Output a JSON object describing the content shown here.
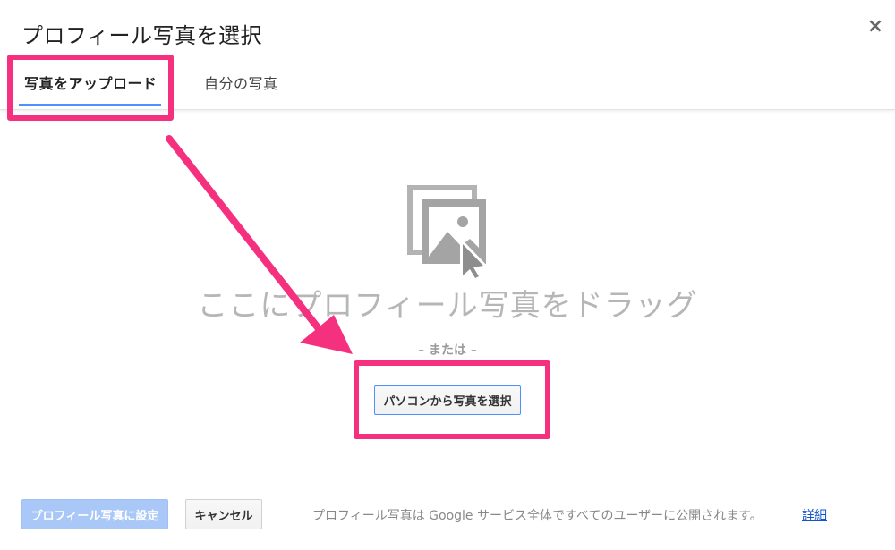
{
  "dialog": {
    "title": "プロフィール写真を選択",
    "close_icon": "close-icon",
    "close_glyph": "×"
  },
  "tabs": [
    {
      "label": "写真をアップロード",
      "active": true
    },
    {
      "label": "自分の写真",
      "active": false
    }
  ],
  "upload_area": {
    "icon": "image-cursor-icon",
    "drag_text": "ここにプロフィール写真をドラッグ",
    "or_text": "– または –",
    "select_button_label": "パソコンから写真を選択"
  },
  "footer": {
    "set_button_label": "プロフィール写真に設定",
    "cancel_button_label": "キャンセル",
    "note": "プロフィール写真は Google サービス全体ですべてのユーザーに公開されます。",
    "details_link": "詳細"
  },
  "colors": {
    "highlight": "#f5317f",
    "accent_blue": "#4d90fe",
    "disabled_button": "#a9c8f8",
    "link": "#1155cc",
    "drag_text": "#b6b6b6"
  }
}
